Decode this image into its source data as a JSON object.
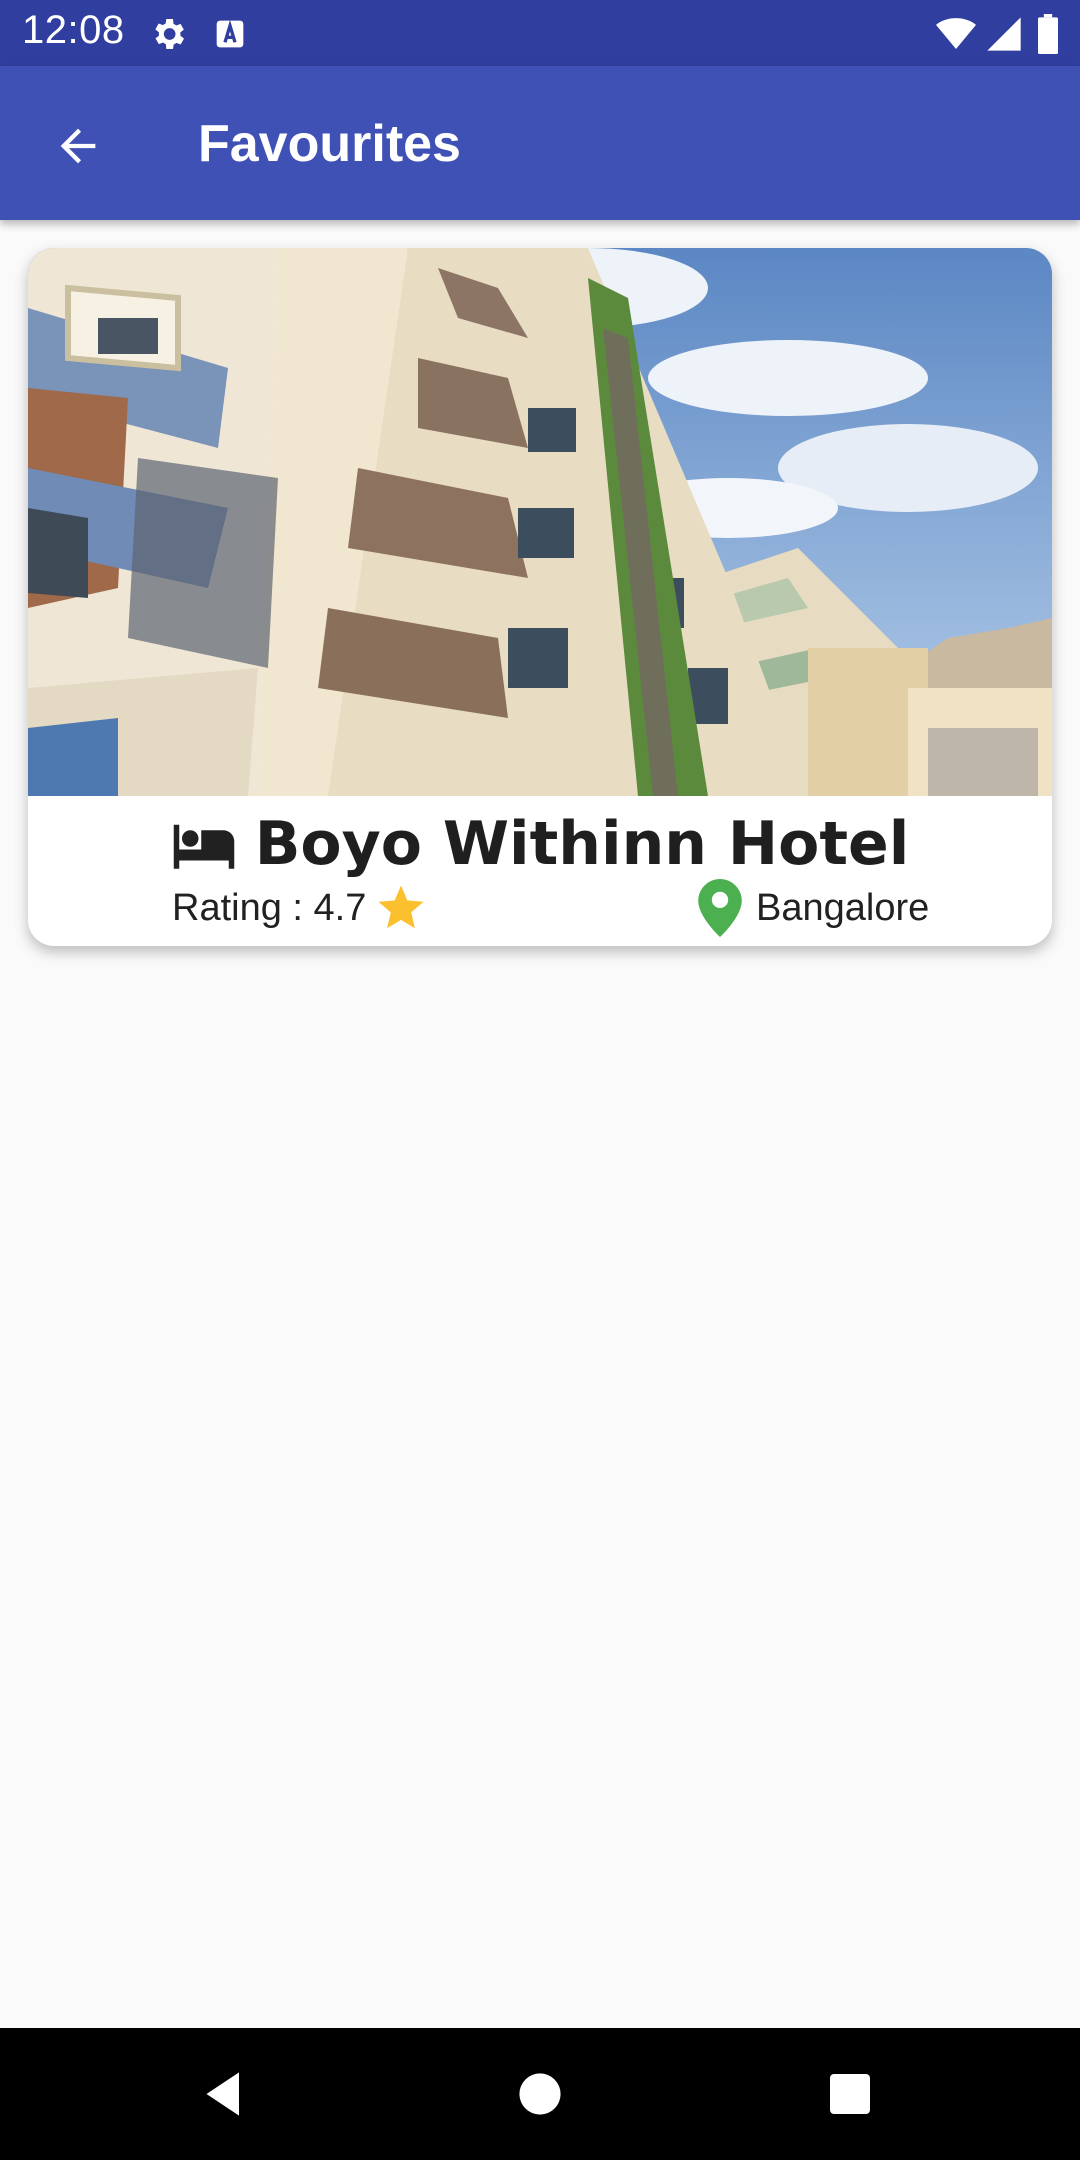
{
  "status_bar": {
    "time": "12:08",
    "background": "#303f9f",
    "icons": [
      "settings-icon",
      "text-a-icon",
      "wifi-icon",
      "signal-icon",
      "battery-icon"
    ]
  },
  "app_bar": {
    "title": "Favourites",
    "background": "#3f51b5",
    "back_icon": "arrow-back-icon"
  },
  "favourites": [
    {
      "name": "Boyo Withinn Hotel",
      "rating_text": "Rating : 4.7",
      "location": "Bangalore",
      "icons": {
        "type": "bed-icon",
        "rating": "star-icon",
        "location": "location-pin-icon"
      },
      "colors": {
        "star": "#fbc02d",
        "pin": "#4caf50"
      }
    }
  ],
  "nav_bar": {
    "buttons": [
      "back-triangle-icon",
      "home-circle-icon",
      "recents-square-icon"
    ]
  }
}
